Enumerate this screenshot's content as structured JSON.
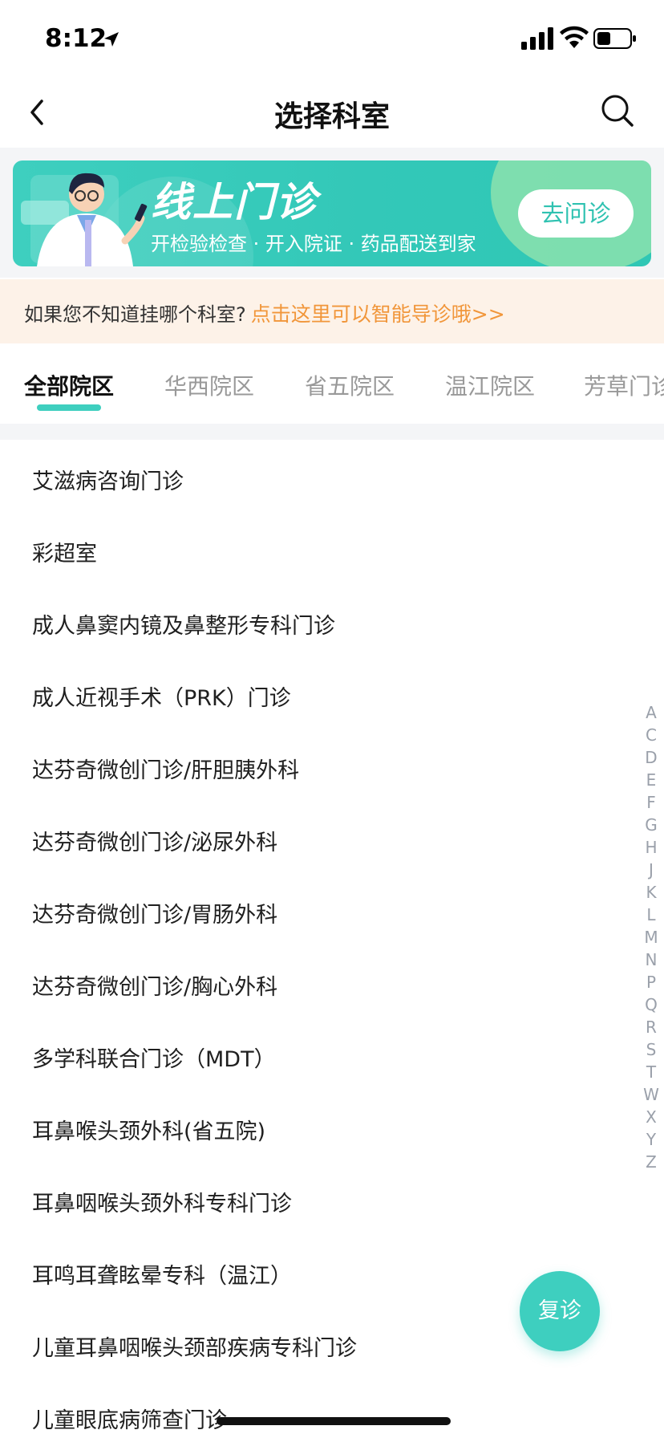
{
  "status_bar": {
    "time": "8:12"
  },
  "header": {
    "title": "选择科室"
  },
  "banner": {
    "title": "线上门诊",
    "subtitle": "开检验检查 · 开入院证 · 药品配送到家",
    "button_label": "去问诊",
    "accent_color": "#3ecfbf"
  },
  "notice": {
    "prefix": "如果您不知道挂哪个科室?",
    "link": "点击这里可以智能导诊哦>>",
    "link_color": "#f1963a"
  },
  "tabs": [
    {
      "label": "全部院区",
      "active": true
    },
    {
      "label": "华西院区",
      "active": false
    },
    {
      "label": "省五院区",
      "active": false
    },
    {
      "label": "温江院区",
      "active": false
    },
    {
      "label": "芳草门诊",
      "active": false
    }
  ],
  "departments": [
    "艾滋病咨询门诊",
    "彩超室",
    "成人鼻窦内镜及鼻整形专科门诊",
    "成人近视手术（PRK）门诊",
    "达芬奇微创门诊/肝胆胰外科",
    "达芬奇微创门诊/泌尿外科",
    "达芬奇微创门诊/胃肠外科",
    "达芬奇微创门诊/胸心外科",
    "多学科联合门诊（MDT）",
    "耳鼻喉头颈外科(省五院)",
    "耳鼻咽喉头颈外科专科门诊",
    "耳鸣耳聋眩晕专科（温江）",
    "儿童耳鼻咽喉头颈部疾病专科门诊",
    "儿童眼底病筛查门诊"
  ],
  "alpha_index": [
    "A",
    "C",
    "D",
    "E",
    "F",
    "G",
    "H",
    "J",
    "K",
    "L",
    "M",
    "N",
    "P",
    "Q",
    "R",
    "S",
    "T",
    "W",
    "X",
    "Y",
    "Z"
  ],
  "revisit_button": "复诊"
}
